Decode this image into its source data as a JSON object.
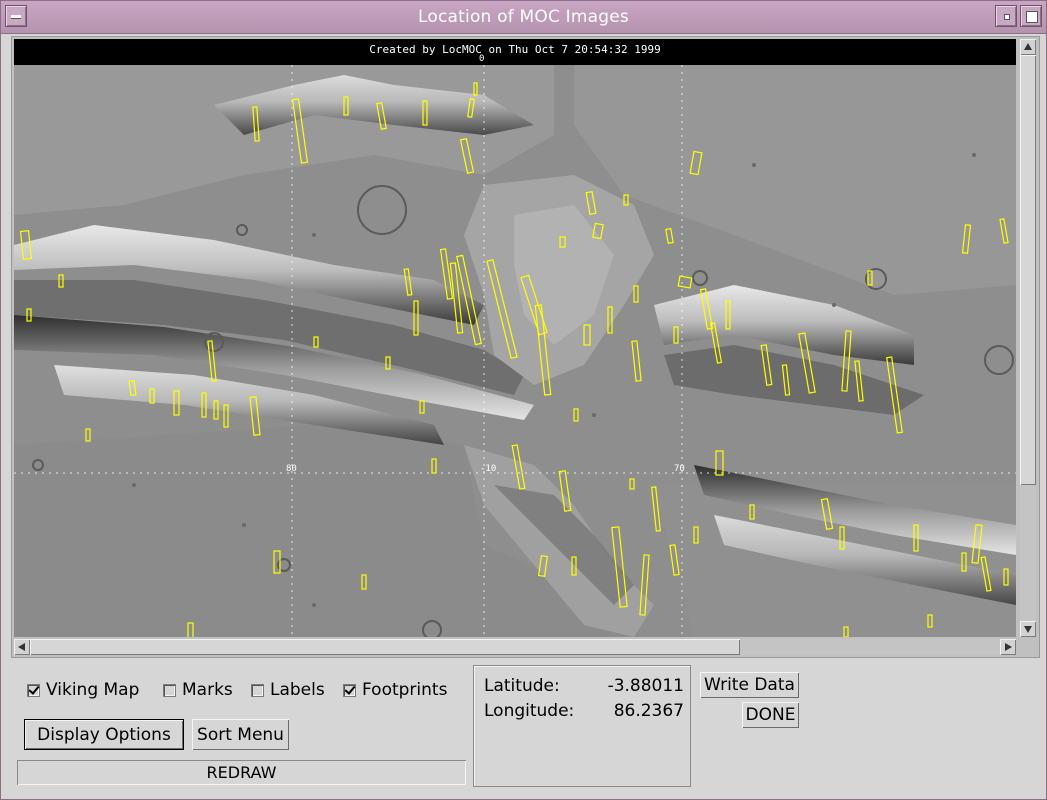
{
  "window": {
    "title": "Location of MOC Images"
  },
  "map": {
    "caption": "Created by LocMOC on Thu Oct  7 20:54:32 1999",
    "grid_labels": {
      "top": "0",
      "lon_80": "80",
      "lat_minus_10": "-10",
      "lon_70": "70"
    },
    "footprint_color": "#ffff00"
  },
  "options": {
    "viking_map": {
      "label": "Viking Map",
      "checked": true
    },
    "marks": {
      "label": "Marks",
      "checked": false
    },
    "labels": {
      "label": "Labels",
      "checked": false
    },
    "footprints": {
      "label": "Footprints",
      "checked": true
    }
  },
  "buttons": {
    "display_options": "Display Options",
    "sort_menu": "Sort Menu",
    "redraw": "REDRAW",
    "write_data": "Write Data",
    "done": "DONE"
  },
  "coords": {
    "latitude_label": "Latitude:",
    "latitude_value": "-3.88011",
    "longitude_label": "Longitude:",
    "longitude_value": "86.2367"
  }
}
